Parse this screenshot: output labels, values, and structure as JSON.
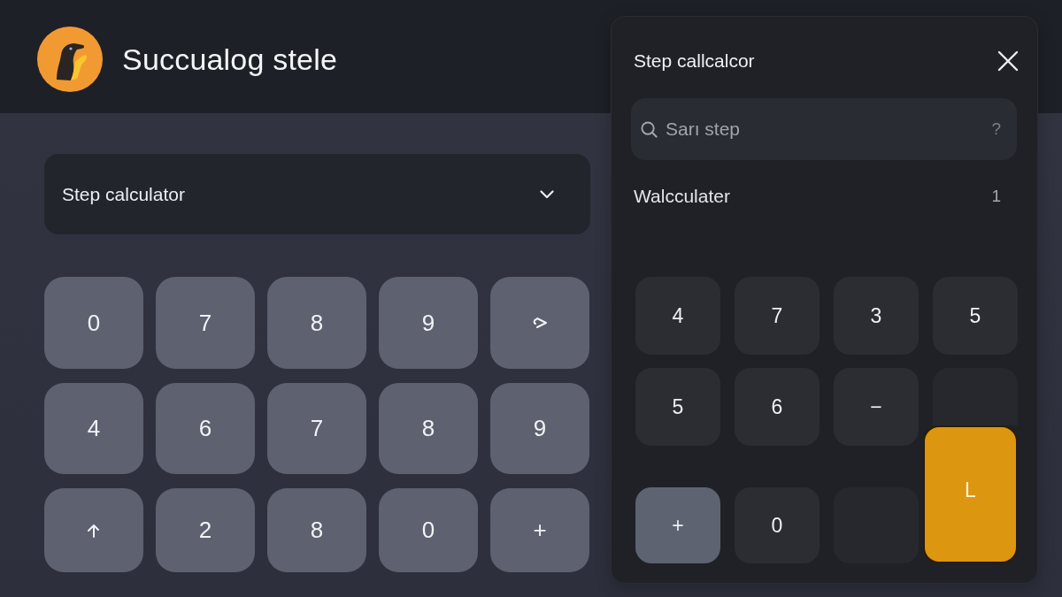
{
  "header": {
    "title": "Succualog stele"
  },
  "dropdown": {
    "value": "Step calculator"
  },
  "keypad": {
    "rows": [
      [
        {
          "kind": "text",
          "label": "0"
        },
        {
          "kind": "text",
          "label": "7"
        },
        {
          "kind": "text",
          "label": "8"
        },
        {
          "kind": "text",
          "label": "9"
        },
        {
          "kind": "chevron"
        }
      ],
      [
        {
          "kind": "text",
          "label": "4"
        },
        {
          "kind": "text",
          "label": "6"
        },
        {
          "kind": "text",
          "label": "7"
        },
        {
          "kind": "text",
          "label": "8"
        },
        {
          "kind": "text",
          "label": "9"
        }
      ],
      [
        {
          "kind": "arrow"
        },
        {
          "kind": "text",
          "label": "2"
        },
        {
          "kind": "text",
          "label": "8"
        },
        {
          "kind": "text",
          "label": "0"
        },
        {
          "kind": "text",
          "label": "+"
        }
      ]
    ]
  },
  "panel": {
    "title": "Step callcalcor",
    "search": {
      "placeholder": "Sarı step",
      "help": "?"
    },
    "items": [
      {
        "label": "Walcculater",
        "count": "1"
      }
    ],
    "keypad": {
      "rows": [
        [
          {
            "kind": "plain",
            "label": "4"
          },
          {
            "kind": "plain",
            "label": "7"
          },
          {
            "kind": "plain",
            "label": "3"
          },
          {
            "kind": "plain",
            "label": "5"
          }
        ],
        [
          {
            "kind": "plain",
            "label": "5"
          },
          {
            "kind": "plain",
            "label": "6"
          },
          {
            "kind": "plain",
            "label": "−"
          },
          {
            "kind": "blank"
          }
        ],
        [
          {
            "kind": "light",
            "label": "+"
          },
          {
            "kind": "plain",
            "label": "0"
          },
          {
            "kind": "blank"
          },
          {
            "kind": "accent",
            "label": "L"
          }
        ]
      ]
    }
  }
}
